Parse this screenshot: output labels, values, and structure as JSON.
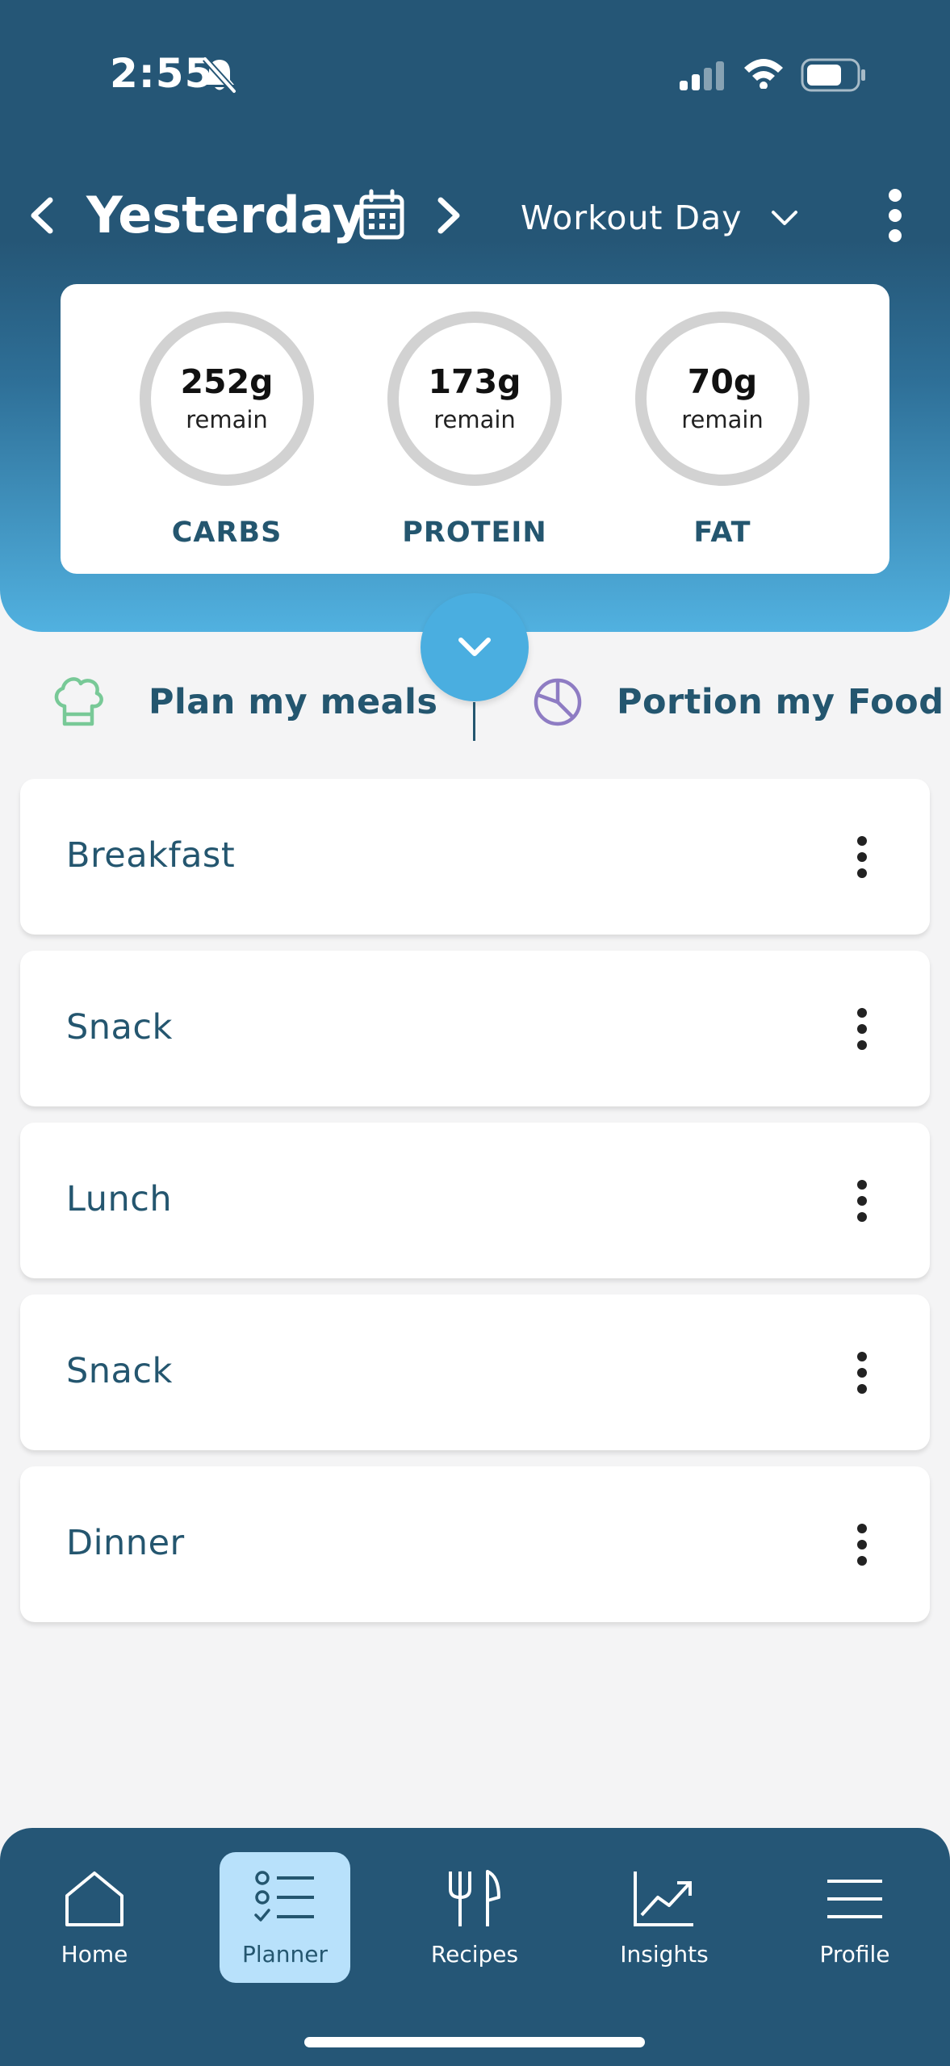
{
  "status_bar": {
    "time": "2:55"
  },
  "header": {
    "day_title": "Yesterday",
    "day_type": "Workout Day"
  },
  "macros": [
    {
      "amount": "252g",
      "remain": "remain",
      "label": "CARBS"
    },
    {
      "amount": "173g",
      "remain": "remain",
      "label": "PROTEIN"
    },
    {
      "amount": "70g",
      "remain": "remain",
      "label": "FAT"
    }
  ],
  "actions": {
    "plan_meals": "Plan my meals",
    "portion_food": "Portion my Food"
  },
  "meals": [
    {
      "name": "Breakfast"
    },
    {
      "name": "Snack"
    },
    {
      "name": "Lunch"
    },
    {
      "name": "Snack"
    },
    {
      "name": "Dinner"
    }
  ],
  "bottom_nav": {
    "tabs": [
      {
        "label": "Home",
        "icon": "home-icon"
      },
      {
        "label": "Planner",
        "icon": "planner-icon",
        "active": true
      },
      {
        "label": "Recipes",
        "icon": "fork-knife-icon"
      },
      {
        "label": "Insights",
        "icon": "chart-icon"
      },
      {
        "label": "Profile",
        "icon": "menu-icon"
      }
    ]
  },
  "colors": {
    "header_dark": "#255676",
    "header_light": "#51b1e0",
    "accent_blue": "#4aaee0",
    "text_navy": "#24566f",
    "active_tab_bg": "#b8e1fb",
    "ring_gray": "#d2d2d2",
    "chef_icon_green": "#78c997",
    "pie_icon_purple": "#8e7cc3"
  }
}
